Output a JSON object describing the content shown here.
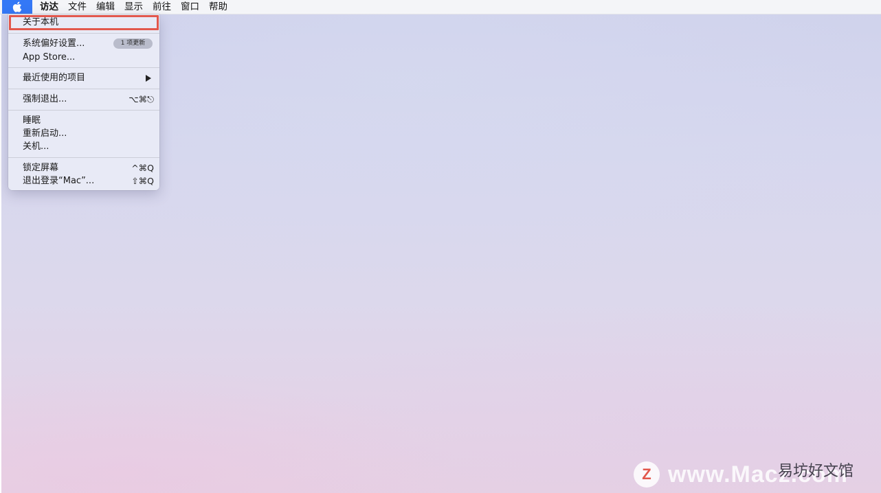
{
  "menubar": {
    "apple_icon": "apple-logo-icon",
    "items": [
      "访达",
      "文件",
      "编辑",
      "显示",
      "前往",
      "窗口",
      "帮助"
    ]
  },
  "apple_menu": {
    "about": "关于本机",
    "system_prefs": "系统偏好设置...",
    "update_badge": "1 项更新",
    "app_store": "App Store...",
    "recent_items": "最近使用的项目",
    "force_quit": "强制退出...",
    "force_quit_shortcut": "⌥⌘⎋",
    "sleep": "睡眠",
    "restart": "重新启动...",
    "shutdown": "关机...",
    "lock_screen": "锁定屏幕",
    "lock_screen_shortcut": "^⌘Q",
    "logout": "退出登录“Mac”...",
    "logout_shortcut": "⇧⌘Q"
  },
  "colors": {
    "apple_button": "#3478f6",
    "highlight_box": "#e2574c"
  },
  "watermark": {
    "logo_letter": "Z",
    "url": "www.Macz.com",
    "site_name": "易坊好文馆"
  }
}
